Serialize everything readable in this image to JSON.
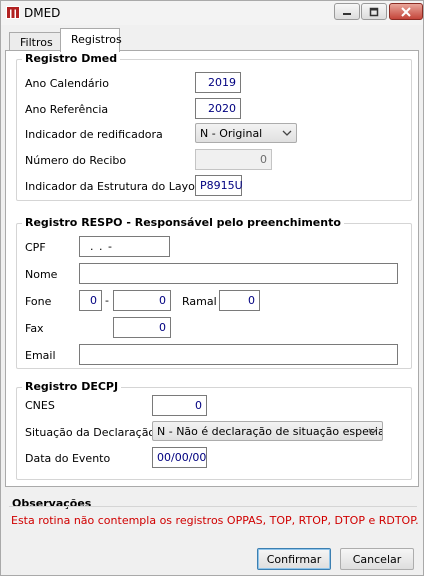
{
  "window": {
    "title": "DMED"
  },
  "tabs": [
    {
      "label": "Filtros"
    },
    {
      "label": "Registros"
    }
  ],
  "dmed": {
    "title": "Registro Dmed",
    "ano_calendario": {
      "label": "Ano Calendário",
      "value": "2019"
    },
    "ano_referencia": {
      "label": "Ano Referência",
      "value": "2020"
    },
    "indicador_redificadora": {
      "label": "Indicador de redificadora",
      "value": "N - Original"
    },
    "numero_recibo": {
      "label": "Número do Recibo",
      "value": "0"
    },
    "estrutura_layout": {
      "label": "Indicador da Estrutura do Layout",
      "value": "P8915U"
    }
  },
  "respo": {
    "title": "Registro RESPO - Responsável pelo preenchimento",
    "cpf": {
      "label": "CPF",
      "value": ".   .   -"
    },
    "nome": {
      "label": "Nome",
      "value": ""
    },
    "fone": {
      "label": "Fone",
      "ddd": "0",
      "separator": "-",
      "numero": "0"
    },
    "ramal": {
      "label": "Ramal",
      "value": "0"
    },
    "fax": {
      "label": "Fax",
      "value": "0"
    },
    "email": {
      "label": "Email",
      "value": ""
    }
  },
  "decpj": {
    "title": "Registro DECPJ",
    "cnes": {
      "label": "CNES",
      "value": "0"
    },
    "situacao": {
      "label": "Situação da Declaração",
      "value": "N - Não é declaração de situação especial"
    },
    "data_evento": {
      "label": "Data do Evento",
      "value": "00/00/00"
    }
  },
  "observacoes": {
    "title": "Observações",
    "text": "Esta rotina não contempla os registros OPPAS, TOP, RTOP, DTOP e RDTOP."
  },
  "buttons": {
    "confirm": "Confirmar",
    "cancel": "Cancelar"
  },
  "colors": {
    "observation_text": "#d00000",
    "field_value": "#000080",
    "close_button": "#c4453a"
  }
}
